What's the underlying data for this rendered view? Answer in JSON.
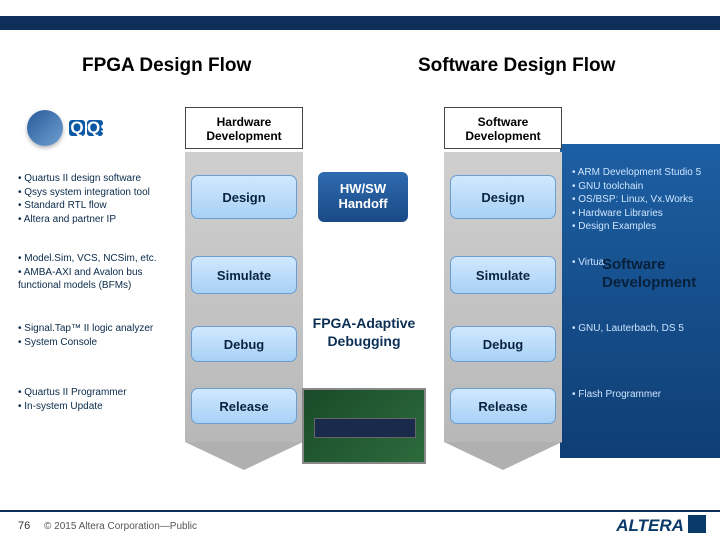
{
  "titles": {
    "fpga": "FPGA Design Flow",
    "software": "Software Design Flow"
  },
  "headers": {
    "hardware": "Hardware\nDevelopment",
    "software": "Software\nDevelopment"
  },
  "stages": {
    "design": "Design",
    "simulate": "Simulate",
    "debug": "Debug",
    "release": "Release"
  },
  "handoff": "HW/SW\nHandoff",
  "adaptive": "FPGA-Adaptive\nDebugging",
  "logos": {
    "qsys": "Qsys"
  },
  "left_notes": {
    "design": [
      "Quartus II design software",
      "Qsys system integration tool",
      "Standard RTL flow",
      "Altera and partner IP"
    ],
    "simulate": [
      "Model.Sim, VCS, NCSim, etc.",
      "AMBA-AXI and Avalon bus functional models (BFMs)"
    ],
    "debug": [
      "Signal.Tap™ II logic analyzer",
      "System Console"
    ],
    "release": [
      "Quartus II Programmer",
      "In-system Update"
    ]
  },
  "right_notes": {
    "design": [
      "ARM Development Studio 5",
      "GNU toolchain",
      "OS/BSP: Linux, Vx.Works",
      "Hardware Libraries",
      "Design Examples"
    ],
    "simulate_prefix": "Virtua",
    "big_label": "Software\nDevelopment",
    "debug": [
      "GNU, Lauterbach, DS 5"
    ],
    "release": [
      "Flash Programmer"
    ]
  },
  "footer": {
    "page": "76",
    "copyright": "© 2015 Altera Corporation—Public",
    "brand": "ALTERA"
  }
}
